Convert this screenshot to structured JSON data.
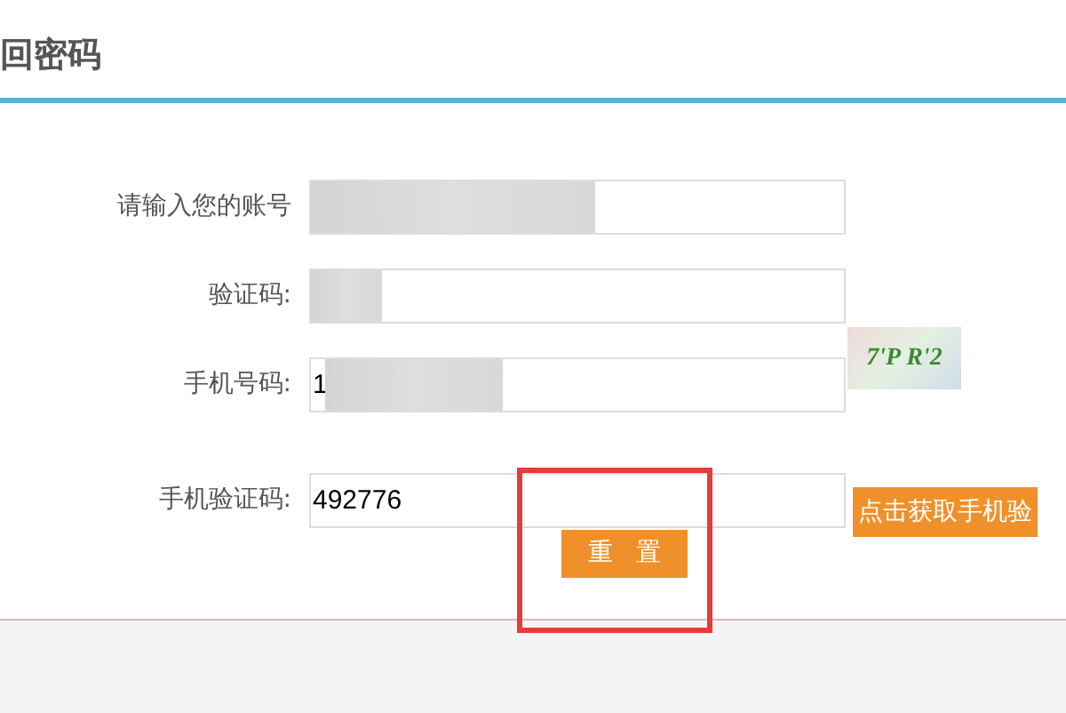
{
  "title": "回密码",
  "fields": [
    {
      "label": "请输入您的账号",
      "redacted": true,
      "kind": "text"
    },
    {
      "label": "验证码:",
      "redacted": true,
      "kind": "captcha",
      "captcha_text": "7'P R'2"
    },
    {
      "label": "手机号码:",
      "value": "1",
      "redacted": true,
      "kind": "text"
    },
    {
      "label": "手机验证码:",
      "value": "492776",
      "kind": "sms",
      "button": "点击获取手机验"
    }
  ],
  "reset_button": "重 置",
  "highlight": true
}
